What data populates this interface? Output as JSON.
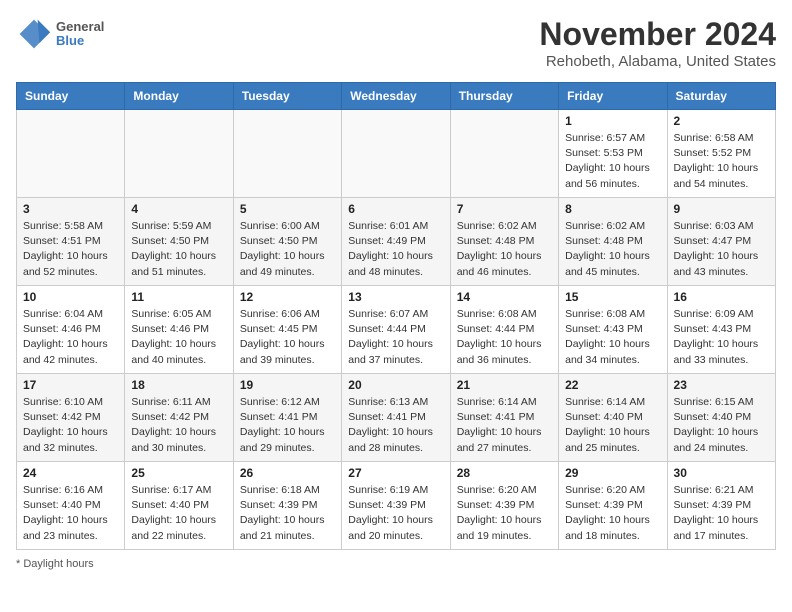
{
  "logo": {
    "line1": "General",
    "line2": "Blue"
  },
  "title": "November 2024",
  "subtitle": "Rehobeth, Alabama, United States",
  "days_of_week": [
    "Sunday",
    "Monday",
    "Tuesday",
    "Wednesday",
    "Thursday",
    "Friday",
    "Saturday"
  ],
  "footer": "Daylight hours",
  "weeks": [
    [
      {
        "day": "",
        "info": ""
      },
      {
        "day": "",
        "info": ""
      },
      {
        "day": "",
        "info": ""
      },
      {
        "day": "",
        "info": ""
      },
      {
        "day": "",
        "info": ""
      },
      {
        "day": "1",
        "info": "Sunrise: 6:57 AM\nSunset: 5:53 PM\nDaylight: 10 hours\nand 56 minutes."
      },
      {
        "day": "2",
        "info": "Sunrise: 6:58 AM\nSunset: 5:52 PM\nDaylight: 10 hours\nand 54 minutes."
      }
    ],
    [
      {
        "day": "3",
        "info": "Sunrise: 5:58 AM\nSunset: 4:51 PM\nDaylight: 10 hours\nand 52 minutes."
      },
      {
        "day": "4",
        "info": "Sunrise: 5:59 AM\nSunset: 4:50 PM\nDaylight: 10 hours\nand 51 minutes."
      },
      {
        "day": "5",
        "info": "Sunrise: 6:00 AM\nSunset: 4:50 PM\nDaylight: 10 hours\nand 49 minutes."
      },
      {
        "day": "6",
        "info": "Sunrise: 6:01 AM\nSunset: 4:49 PM\nDaylight: 10 hours\nand 48 minutes."
      },
      {
        "day": "7",
        "info": "Sunrise: 6:02 AM\nSunset: 4:48 PM\nDaylight: 10 hours\nand 46 minutes."
      },
      {
        "day": "8",
        "info": "Sunrise: 6:02 AM\nSunset: 4:48 PM\nDaylight: 10 hours\nand 45 minutes."
      },
      {
        "day": "9",
        "info": "Sunrise: 6:03 AM\nSunset: 4:47 PM\nDaylight: 10 hours\nand 43 minutes."
      }
    ],
    [
      {
        "day": "10",
        "info": "Sunrise: 6:04 AM\nSunset: 4:46 PM\nDaylight: 10 hours\nand 42 minutes."
      },
      {
        "day": "11",
        "info": "Sunrise: 6:05 AM\nSunset: 4:46 PM\nDaylight: 10 hours\nand 40 minutes."
      },
      {
        "day": "12",
        "info": "Sunrise: 6:06 AM\nSunset: 4:45 PM\nDaylight: 10 hours\nand 39 minutes."
      },
      {
        "day": "13",
        "info": "Sunrise: 6:07 AM\nSunset: 4:44 PM\nDaylight: 10 hours\nand 37 minutes."
      },
      {
        "day": "14",
        "info": "Sunrise: 6:08 AM\nSunset: 4:44 PM\nDaylight: 10 hours\nand 36 minutes."
      },
      {
        "day": "15",
        "info": "Sunrise: 6:08 AM\nSunset: 4:43 PM\nDaylight: 10 hours\nand 34 minutes."
      },
      {
        "day": "16",
        "info": "Sunrise: 6:09 AM\nSunset: 4:43 PM\nDaylight: 10 hours\nand 33 minutes."
      }
    ],
    [
      {
        "day": "17",
        "info": "Sunrise: 6:10 AM\nSunset: 4:42 PM\nDaylight: 10 hours\nand 32 minutes."
      },
      {
        "day": "18",
        "info": "Sunrise: 6:11 AM\nSunset: 4:42 PM\nDaylight: 10 hours\nand 30 minutes."
      },
      {
        "day": "19",
        "info": "Sunrise: 6:12 AM\nSunset: 4:41 PM\nDaylight: 10 hours\nand 29 minutes."
      },
      {
        "day": "20",
        "info": "Sunrise: 6:13 AM\nSunset: 4:41 PM\nDaylight: 10 hours\nand 28 minutes."
      },
      {
        "day": "21",
        "info": "Sunrise: 6:14 AM\nSunset: 4:41 PM\nDaylight: 10 hours\nand 27 minutes."
      },
      {
        "day": "22",
        "info": "Sunrise: 6:14 AM\nSunset: 4:40 PM\nDaylight: 10 hours\nand 25 minutes."
      },
      {
        "day": "23",
        "info": "Sunrise: 6:15 AM\nSunset: 4:40 PM\nDaylight: 10 hours\nand 24 minutes."
      }
    ],
    [
      {
        "day": "24",
        "info": "Sunrise: 6:16 AM\nSunset: 4:40 PM\nDaylight: 10 hours\nand 23 minutes."
      },
      {
        "day": "25",
        "info": "Sunrise: 6:17 AM\nSunset: 4:40 PM\nDaylight: 10 hours\nand 22 minutes."
      },
      {
        "day": "26",
        "info": "Sunrise: 6:18 AM\nSunset: 4:39 PM\nDaylight: 10 hours\nand 21 minutes."
      },
      {
        "day": "27",
        "info": "Sunrise: 6:19 AM\nSunset: 4:39 PM\nDaylight: 10 hours\nand 20 minutes."
      },
      {
        "day": "28",
        "info": "Sunrise: 6:20 AM\nSunset: 4:39 PM\nDaylight: 10 hours\nand 19 minutes."
      },
      {
        "day": "29",
        "info": "Sunrise: 6:20 AM\nSunset: 4:39 PM\nDaylight: 10 hours\nand 18 minutes."
      },
      {
        "day": "30",
        "info": "Sunrise: 6:21 AM\nSunset: 4:39 PM\nDaylight: 10 hours\nand 17 minutes."
      }
    ]
  ]
}
